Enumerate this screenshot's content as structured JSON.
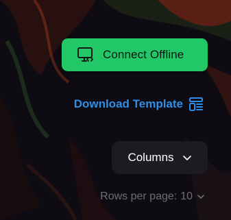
{
  "actions": {
    "connect_label": "Connect Offline",
    "connect_icon": "monitor-code-icon",
    "download_label": "Download Template",
    "download_icon": "template-layout-icon",
    "columns_label": "Columns",
    "columns_icon": "chevron-down-icon"
  },
  "pagination": {
    "rows_per_page_label": "Rows per page:",
    "rows_per_page_value": "10",
    "rows_per_page_icon": "chevron-down-icon"
  },
  "colors": {
    "connect_bg": "#22c768",
    "link_blue": "#2f8fe8",
    "columns_bg": "#1c1b20",
    "muted_text": "#6e6c74"
  }
}
